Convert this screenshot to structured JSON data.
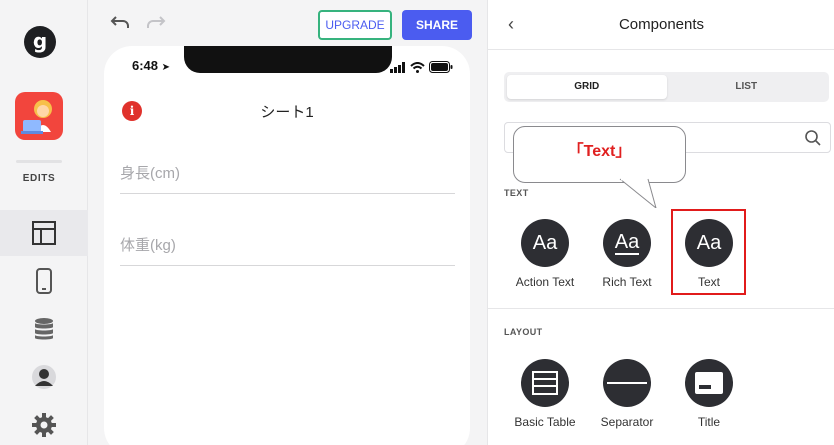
{
  "rail": {
    "logo": "g",
    "edits_label": "EDITS",
    "nav_items": [
      "layout",
      "phone",
      "data",
      "users",
      "settings"
    ]
  },
  "toolbar": {
    "upgrade_label": "UPGRADE",
    "share_label": "SHARE"
  },
  "phone": {
    "time": "6:48",
    "screen_title": "シート1",
    "info_badge": "i",
    "fields": [
      "身長(cm)",
      "体重(kg)"
    ]
  },
  "panel": {
    "title": "Components",
    "back_glyph": "‹",
    "tabs": [
      {
        "label": "GRID",
        "active": true
      },
      {
        "label": "LIST",
        "active": false
      }
    ],
    "callout_text": "「Text」",
    "sections": [
      {
        "label": "TEXT",
        "items": [
          {
            "label": "Action Text",
            "glyph": "Aa"
          },
          {
            "label": "Rich Text",
            "glyph": "Aa"
          },
          {
            "label": "Text",
            "glyph": "Aa"
          }
        ]
      },
      {
        "label": "LAYOUT",
        "items": [
          {
            "label": "Basic Table",
            "icon": "table-icon"
          },
          {
            "label": "Separator",
            "icon": "separator-icon"
          },
          {
            "label": "Title",
            "icon": "title-icon"
          }
        ]
      }
    ]
  },
  "colors": {
    "accent": "#4b5cf0",
    "upgrade_border": "#36b37e",
    "highlight": "#e11b1b",
    "callout_text": "#e02020",
    "component_circle": "#2d2e33"
  }
}
